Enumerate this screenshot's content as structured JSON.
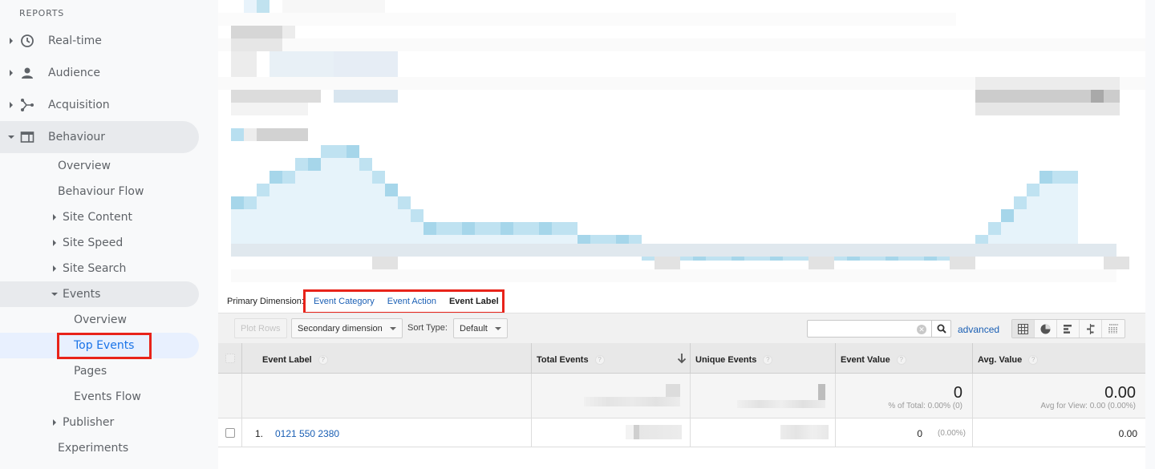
{
  "sidebar": {
    "heading": "REPORTS",
    "items": [
      {
        "label": "Real-time",
        "icon": "clock-icon",
        "expanded": false
      },
      {
        "label": "Audience",
        "icon": "person-icon",
        "expanded": false
      },
      {
        "label": "Acquisition",
        "icon": "acquisition-icon",
        "expanded": false
      },
      {
        "label": "Behaviour",
        "icon": "behaviour-icon",
        "expanded": true
      }
    ],
    "behaviour_children": {
      "overview": "Overview",
      "behaviour_flow": "Behaviour Flow",
      "site_content": "Site Content",
      "site_speed": "Site Speed",
      "site_search": "Site Search",
      "events": "Events",
      "events_children": {
        "overview": "Overview",
        "top_events": "Top Events",
        "pages": "Pages",
        "events_flow": "Events Flow"
      },
      "publisher": "Publisher",
      "experiments": "Experiments"
    },
    "selected": "Top Events"
  },
  "dimensions": {
    "label": "Primary Dimension:",
    "options": [
      "Event Category",
      "Event Action",
      "Event Label"
    ],
    "current": "Event Label"
  },
  "toolbar": {
    "plot_rows": "Plot Rows",
    "secondary_dimension": "Secondary dimension",
    "sort_type_label": "Sort Type:",
    "sort_type_value": "Default",
    "search_value": "",
    "search_placeholder": "",
    "advanced": "advanced",
    "views": [
      "table-view",
      "pie-view",
      "performance-view",
      "comparison-view",
      "pivot-view"
    ],
    "active_view": "table-view"
  },
  "table": {
    "headers": {
      "label": "Event Label",
      "total_events": "Total Events",
      "unique_events": "Unique Events",
      "event_value": "Event Value",
      "avg_value": "Avg. Value"
    },
    "sorted_by": "Total Events",
    "sort_direction": "descending",
    "totals": {
      "total_events": "(obscured)",
      "unique_events": "(obscured)",
      "event_value": "0",
      "event_value_sub": "% of Total: 0.00% (0)",
      "avg_value": "0.00",
      "avg_value_sub": "Avg for View: 0.00 (0.00%)"
    },
    "rows": [
      {
        "index": "1.",
        "label": "0121 550 2380",
        "total_events": "(obscured)",
        "unique_events": "(obscured)",
        "event_value": "0",
        "event_value_pct": "(0.00%)",
        "avg_value": "0.00"
      }
    ]
  },
  "colors": {
    "accent_blue": "#1a73e8",
    "link_blue": "#1a5fb4",
    "highlight_red": "#e8231a",
    "chart_line": "#a8d8ec",
    "chart_fill": "#e6f3fa"
  }
}
